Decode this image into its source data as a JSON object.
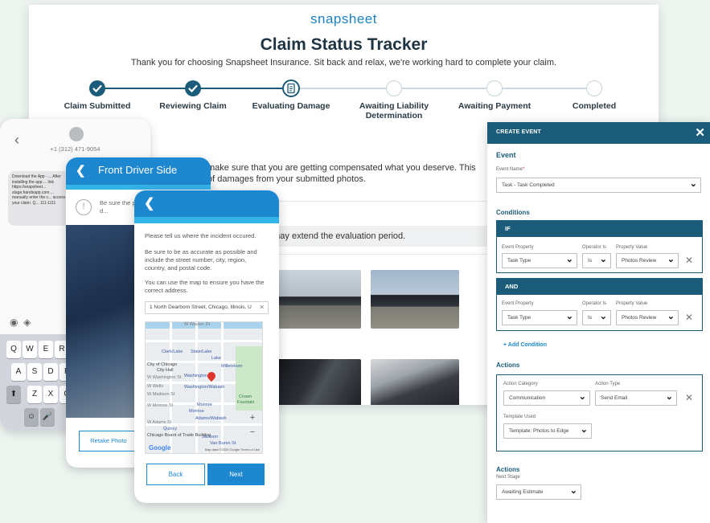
{
  "tracker": {
    "logo": "snapsheet",
    "title": "Claim Status Tracker",
    "tagline": "Thank you for choosing Snapsheet Insurance. Sit back and relax, we're working hard to complete your claim.",
    "steps": [
      {
        "label": "Claim Submitted",
        "state": "done"
      },
      {
        "label": "Reviewing Claim",
        "state": "done"
      },
      {
        "label": "Evaluating Damage",
        "state": "current"
      },
      {
        "label": "Awaiting Liability Determination",
        "state": "todo"
      },
      {
        "label": "Awaiting Payment",
        "state": "todo"
      },
      {
        "label": "Completed",
        "state": "todo"
      }
    ],
    "eval_text_line1": "make sure that you are getting compensated what you deserve. This",
    "eval_text_line2": "of damages from your submitted photos.",
    "note": "epair shop. This may extend the evaluation period."
  },
  "sms": {
    "phone_number": "+1 (312) 471-9054",
    "message": "Download the App - ... After installing the app ... link https://snapsheet... stage.handsapp.com ... manually enter the c... access your claim. Q... 111-1111",
    "keys_row1": [
      "Q",
      "W",
      "E",
      "R"
    ],
    "keys_row2": [
      "A",
      "S",
      "D",
      "F"
    ],
    "keys_row3": [
      "Z",
      "X",
      "C"
    ]
  },
  "driver": {
    "title": "Front Driver Side",
    "tip": "Be sure the p... covered by d...",
    "retake_label": "Retake Photo"
  },
  "location": {
    "p1": "Please tell us where the incident occured.",
    "p2": "Be sure to be as accurate as possible and include the street number, city, region, country, and postal code.",
    "p3": "You can use the map to ensure you have the correct address.",
    "address_value": "1 North Dearborn Street, Chicago, Illinois, U",
    "map_labels": {
      "clark_lake": "Clark/Lake",
      "state_lake": "State/Lake",
      "lake": "Lake",
      "millennium": "Millennium",
      "city_of_chicago": "City of Chicago",
      "city_hall": "City Hall",
      "washington": "Washington",
      "washington_wabash": "Washington/Wabash",
      "monroe": "Monroe",
      "adams_wabash": "Adams/Wabash",
      "quincy": "Quincy",
      "chicago_board": "Chicago Board of Trade Building",
      "jackson": "Jackson",
      "van_buren": "Van Buren St",
      "w_madison": "W Madison St",
      "w_monroe": "W Monroe St",
      "w_adams": "W Adams St",
      "w_washington": "W Washington St",
      "w_wacker": "W Wacker Dr",
      "w_wells": "W Wells",
      "crown": "Crown",
      "fountain": "Fountain"
    },
    "map_brand": "Google",
    "map_credit": "Map data ©2020 Google   Terms of Use",
    "back_label": "Back",
    "next_label": "Next"
  },
  "event_panel": {
    "header": "CREATE EVENT",
    "section_event": "Event",
    "event_name_label": "Event Name",
    "event_name_value": "Task - Task Completed",
    "section_conditions": "Conditions",
    "if_label": "IF",
    "and_label": "AND",
    "col_event_property": "Event Property",
    "col_operator": "Operator Is",
    "col_property_value": "Property Value",
    "cond1": {
      "property": "Task Type",
      "operator": "Is",
      "value": "Photos Review"
    },
    "cond2": {
      "property": "Task Type",
      "operator": "Is",
      "value": "Photos Review"
    },
    "add_condition": "+ Add Condition",
    "section_actions": "Actions",
    "col_action_category": "Action Category",
    "col_action_type": "Action Type",
    "action_category_value": "Communication",
    "action_type_value": "Send Email",
    "template_label": "Template Used",
    "template_value": "Template: Photos to Edge",
    "section_actions2": "Actions",
    "next_stage_label": "Next Stage",
    "next_stage_value": "Awaiting Estimate"
  },
  "colors": {
    "brand_blue": "#1d87cf",
    "dark_teal": "#1a5c7a",
    "light_blue": "#34b3ea",
    "background": "#eef5f1"
  }
}
